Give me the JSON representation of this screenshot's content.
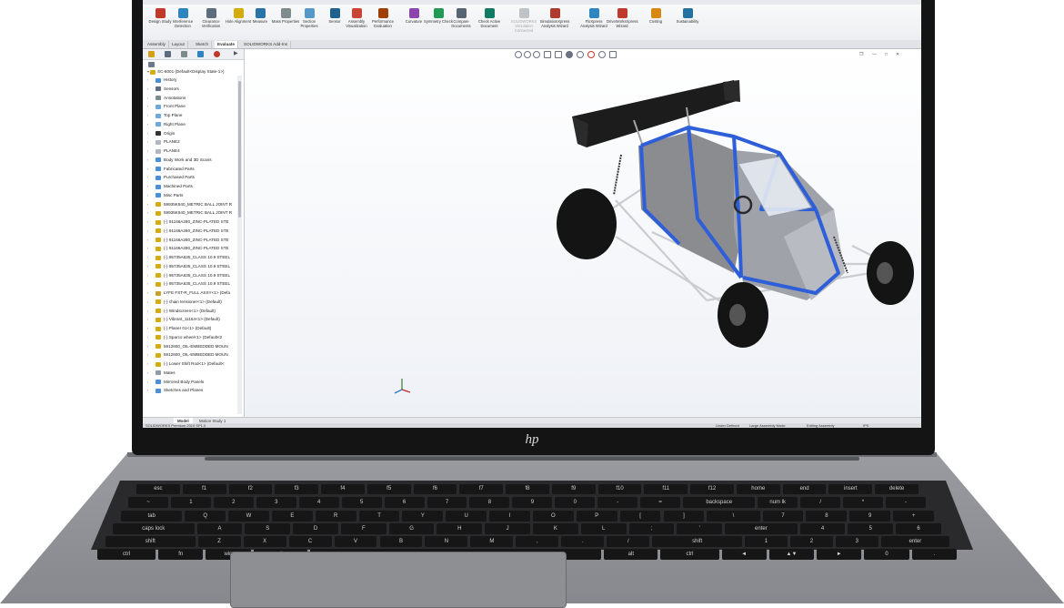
{
  "ribbon": {
    "buttons": [
      {
        "label": "Design Study",
        "icon": "design-study-icon",
        "color": "#c0392b"
      },
      {
        "label": "Interference Detection",
        "icon": "interference-icon",
        "color": "#2e86c1"
      },
      {
        "label": "Clearance Verification",
        "icon": "clearance-icon",
        "color": "#5d6d7e"
      },
      {
        "label": "Hole Alignment",
        "icon": "hole-icon",
        "color": "#d4ac0d"
      },
      {
        "label": "Measure",
        "icon": "measure-icon",
        "color": "#2874a6"
      },
      {
        "label": "Mass Properties",
        "icon": "mass-icon",
        "color": "#7f8c8d"
      },
      {
        "label": "Section Properties",
        "icon": "section-icon",
        "color": "#5499c7"
      },
      {
        "label": "Sensor",
        "icon": "sensor-icon",
        "color": "#1f618d"
      },
      {
        "label": "Assembly Visualization",
        "icon": "assembly-vis-icon",
        "color": "#cb4335"
      },
      {
        "label": "Performance Evaluation",
        "icon": "performance-icon",
        "color": "#a04000"
      },
      {
        "label": "Curvature",
        "icon": "curvature-icon",
        "color": "#8e44ad"
      },
      {
        "label": "Symmetry Check",
        "icon": "symmetry-icon",
        "color": "#229954"
      },
      {
        "label": "Compare Documents",
        "icon": "compare-icon",
        "color": "#566573"
      },
      {
        "label": "Check Active Document",
        "icon": "check-icon",
        "color": "#117a65"
      },
      {
        "label": "SOLIDWORKS Simulation Connected",
        "icon": "simulation-icon",
        "color": "#bdc3c7",
        "dim": true
      },
      {
        "label": "SimulationXpress Analysis Wizard",
        "icon": "simxpress-icon",
        "color": "#b03a2e"
      },
      {
        "label": "FloXpress Analysis Wizard",
        "icon": "floxpress-icon",
        "color": "#2e86c1"
      },
      {
        "label": "DriveWorksXpress Wizard",
        "icon": "driveworks-icon",
        "color": "#c0392b"
      },
      {
        "label": "Costing",
        "icon": "costing-icon",
        "color": "#d68910"
      },
      {
        "label": "Sustainability",
        "icon": "sustainability-icon",
        "color": "#2471a3"
      }
    ]
  },
  "tabs": [
    "Assembly",
    "Layout",
    "Sketch",
    "Evaluate",
    "SOLIDWORKS Add-Ins"
  ],
  "active_tab": "Evaluate",
  "tree": {
    "root": "SC-6001 (Default<Display State-1>)",
    "items": [
      {
        "label": "History",
        "icon": "folder"
      },
      {
        "label": "Sensors",
        "icon": "sensor"
      },
      {
        "label": "Annotations",
        "icon": "annotation"
      },
      {
        "label": "Front Plane",
        "icon": "plane"
      },
      {
        "label": "Top Plane",
        "icon": "plane"
      },
      {
        "label": "Right Plane",
        "icon": "plane"
      },
      {
        "label": "Origin",
        "icon": "origin"
      },
      {
        "label": "PLANE2",
        "icon": "plane2"
      },
      {
        "label": "PLANE4",
        "icon": "plane2"
      },
      {
        "label": "Body Work and 3D Scans",
        "icon": "folder"
      },
      {
        "label": "Fabricated Parts",
        "icon": "folder"
      },
      {
        "label": "Purchased Parts",
        "icon": "folder"
      },
      {
        "label": "Machined Parts",
        "icon": "folder"
      },
      {
        "label": "Misc Parts",
        "icon": "folder"
      },
      {
        "label": "59935K840_METRIC BALL JOINT R",
        "icon": "part"
      },
      {
        "label": "59935K840_METRIC BALL JOINT R",
        "icon": "part"
      },
      {
        "label": "(-) 91166A280_ZINC-PLATED STE",
        "icon": "part"
      },
      {
        "label": "(-) 91166A280_ZINC-PLATED STE",
        "icon": "part"
      },
      {
        "label": "(-) 91166A280_ZINC-PLATED STE",
        "icon": "part"
      },
      {
        "label": "(-) 91166A280_ZINC-PLATED STE",
        "icon": "part"
      },
      {
        "label": "(-) 95735A635_CLASS 10.9 STEEL",
        "icon": "part"
      },
      {
        "label": "(-) 95735A635_CLASS 10.9 STEEL",
        "icon": "part"
      },
      {
        "label": "(-) 95735A635_CLASS 10.9 STEEL",
        "icon": "part"
      },
      {
        "label": "(-) 95735A635_CLASS 10.9 STEEL",
        "icon": "part"
      },
      {
        "label": "LYFE FST-R_FULL ASSY<1> (Defa",
        "icon": "assembly"
      },
      {
        "label": "(-) chain tensioner<1> (Default)",
        "icon": "part"
      },
      {
        "label": "(-) Windscreen<1> (Default)",
        "icon": "part"
      },
      {
        "label": "(-) Vibrant_11164<1> (Default)",
        "icon": "part"
      },
      {
        "label": "(-) Planer 01<1> (Default)",
        "icon": "part"
      },
      {
        "label": "(-) Sparco wheel<1> (Default<2",
        "icon": "part"
      },
      {
        "label": "5912600_OIL-EMBEDDED MOUN",
        "icon": "part"
      },
      {
        "label": "5912600_OIL-EMBEDDED MOUN",
        "icon": "part"
      },
      {
        "label": "(-) Lower Shift Rod<1> (Default<",
        "icon": "part"
      },
      {
        "label": "Mates",
        "icon": "mates"
      },
      {
        "label": "Mirrored Body Panels",
        "icon": "folder"
      },
      {
        "label": "Sketches and Planes",
        "icon": "folder"
      }
    ]
  },
  "model_tabs": [
    "Model",
    "Motion Study 1"
  ],
  "status": {
    "left": "SOLIDWORKS Premium 2019 SP1.0",
    "state": "Under Defined",
    "mode": "Large Assembly Mode",
    "editing": "Editing Assembly",
    "units": "IPS"
  },
  "colors": {
    "frame_blue": "#2f5fd8",
    "body_gray": "#8a8c90",
    "chassis": "#c9ccd1",
    "tire": "#141414"
  },
  "brand_logo": "hp",
  "keyboard_rows": [
    [
      "esc",
      "f1",
      "f2",
      "f3",
      "f4",
      "f5",
      "f6",
      "f7",
      "f8",
      "f9",
      "f10",
      "f11",
      "f12",
      "home",
      "end",
      "insert",
      "delete"
    ],
    [
      "~",
      "1",
      "2",
      "3",
      "4",
      "5",
      "6",
      "7",
      "8",
      "9",
      "0",
      "-",
      "=",
      "backspace",
      "num lk",
      "/",
      "*",
      "-"
    ],
    [
      "tab",
      "Q",
      "W",
      "E",
      "R",
      "T",
      "Y",
      "U",
      "I",
      "O",
      "P",
      "[",
      "]",
      "\\",
      "7",
      "8",
      "9",
      "+"
    ],
    [
      "caps lock",
      "A",
      "S",
      "D",
      "F",
      "G",
      "H",
      "J",
      "K",
      "L",
      ";",
      "'",
      "enter",
      "4",
      "5",
      "6"
    ],
    [
      "shift",
      "Z",
      "X",
      "C",
      "V",
      "B",
      "N",
      "M",
      ",",
      ".",
      "/",
      "shift",
      "1",
      "2",
      "3",
      "enter"
    ],
    [
      "ctrl",
      "fn",
      "win",
      "alt",
      "",
      "alt",
      "ctrl",
      "◄",
      "▲▼",
      "►",
      "0",
      "."
    ]
  ]
}
